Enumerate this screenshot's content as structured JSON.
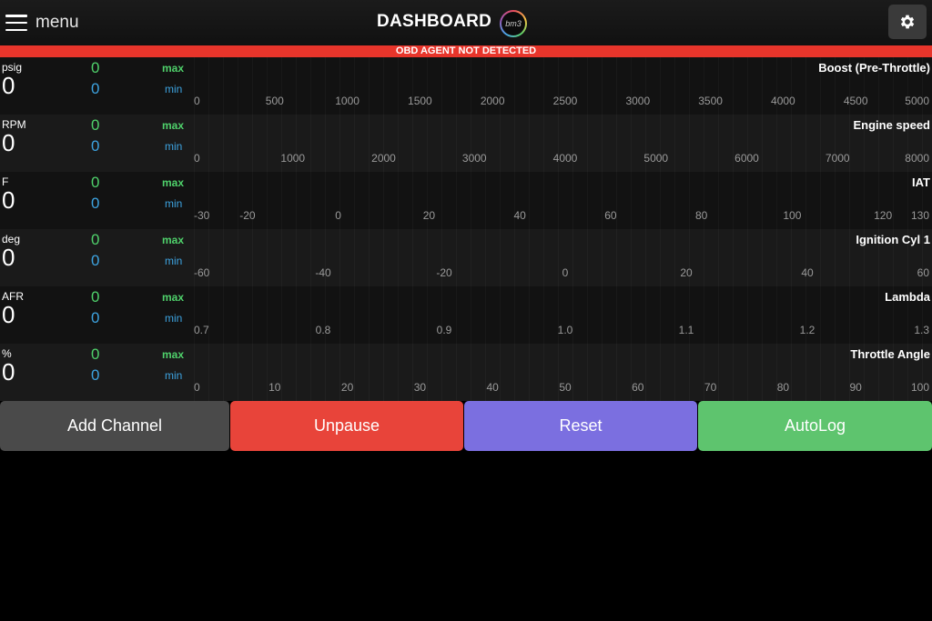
{
  "header": {
    "menu_label": "menu",
    "title": "DASHBOARD",
    "logo_text": "bm3"
  },
  "alert": {
    "text": "OBD AGENT NOT DETECTED",
    "color": "#e8352b"
  },
  "channels": [
    {
      "name": "Boost (Pre-Throttle)",
      "unit": "psig",
      "value": "0",
      "max": "0",
      "min": "0",
      "max_label": "max",
      "min_label": "min",
      "scale": [
        "0",
        "500",
        "1000",
        "1500",
        "2000",
        "2500",
        "3000",
        "3500",
        "4000",
        "4500",
        "5000"
      ]
    },
    {
      "name": "Engine speed",
      "unit": "RPM",
      "value": "0",
      "max": "0",
      "min": "0",
      "max_label": "max",
      "min_label": "min",
      "scale": [
        "0",
        "1000",
        "2000",
        "3000",
        "4000",
        "5000",
        "6000",
        "7000",
        "8000"
      ]
    },
    {
      "name": "IAT",
      "unit": "F",
      "value": "0",
      "max": "0",
      "min": "0",
      "max_label": "max",
      "min_label": "min",
      "scale": [
        "-30",
        "-20",
        "0",
        "20",
        "40",
        "60",
        "80",
        "100",
        "120",
        "130"
      ]
    },
    {
      "name": "Ignition Cyl 1",
      "unit": "deg",
      "value": "0",
      "max": "0",
      "min": "0",
      "max_label": "max",
      "min_label": "min",
      "scale": [
        "-60",
        "-40",
        "-20",
        "0",
        "20",
        "40",
        "60"
      ]
    },
    {
      "name": "Lambda",
      "unit": "AFR",
      "value": "0",
      "max": "0",
      "min": "0",
      "max_label": "max",
      "min_label": "min",
      "scale": [
        "0.7",
        "0.8",
        "0.9",
        "1.0",
        "1.1",
        "1.2",
        "1.3"
      ]
    },
    {
      "name": "Throttle Angle",
      "unit": "%",
      "value": "0",
      "max": "0",
      "min": "0",
      "max_label": "max",
      "min_label": "min",
      "scale": [
        "0",
        "10",
        "20",
        "30",
        "40",
        "50",
        "60",
        "70",
        "80",
        "90",
        "100"
      ]
    }
  ],
  "buttons": {
    "add_channel": "Add Channel",
    "unpause": "Unpause",
    "reset": "Reset",
    "autolog": "AutoLog"
  },
  "colors": {
    "max": "#4fd16b",
    "min": "#3da3e0",
    "add_channel": "#4a4a4a",
    "unpause": "#e8443a",
    "reset": "#7b6fe0",
    "autolog": "#5ec46e"
  },
  "icons": {
    "menu": "hamburger-icon",
    "settings": "gear-icon"
  }
}
